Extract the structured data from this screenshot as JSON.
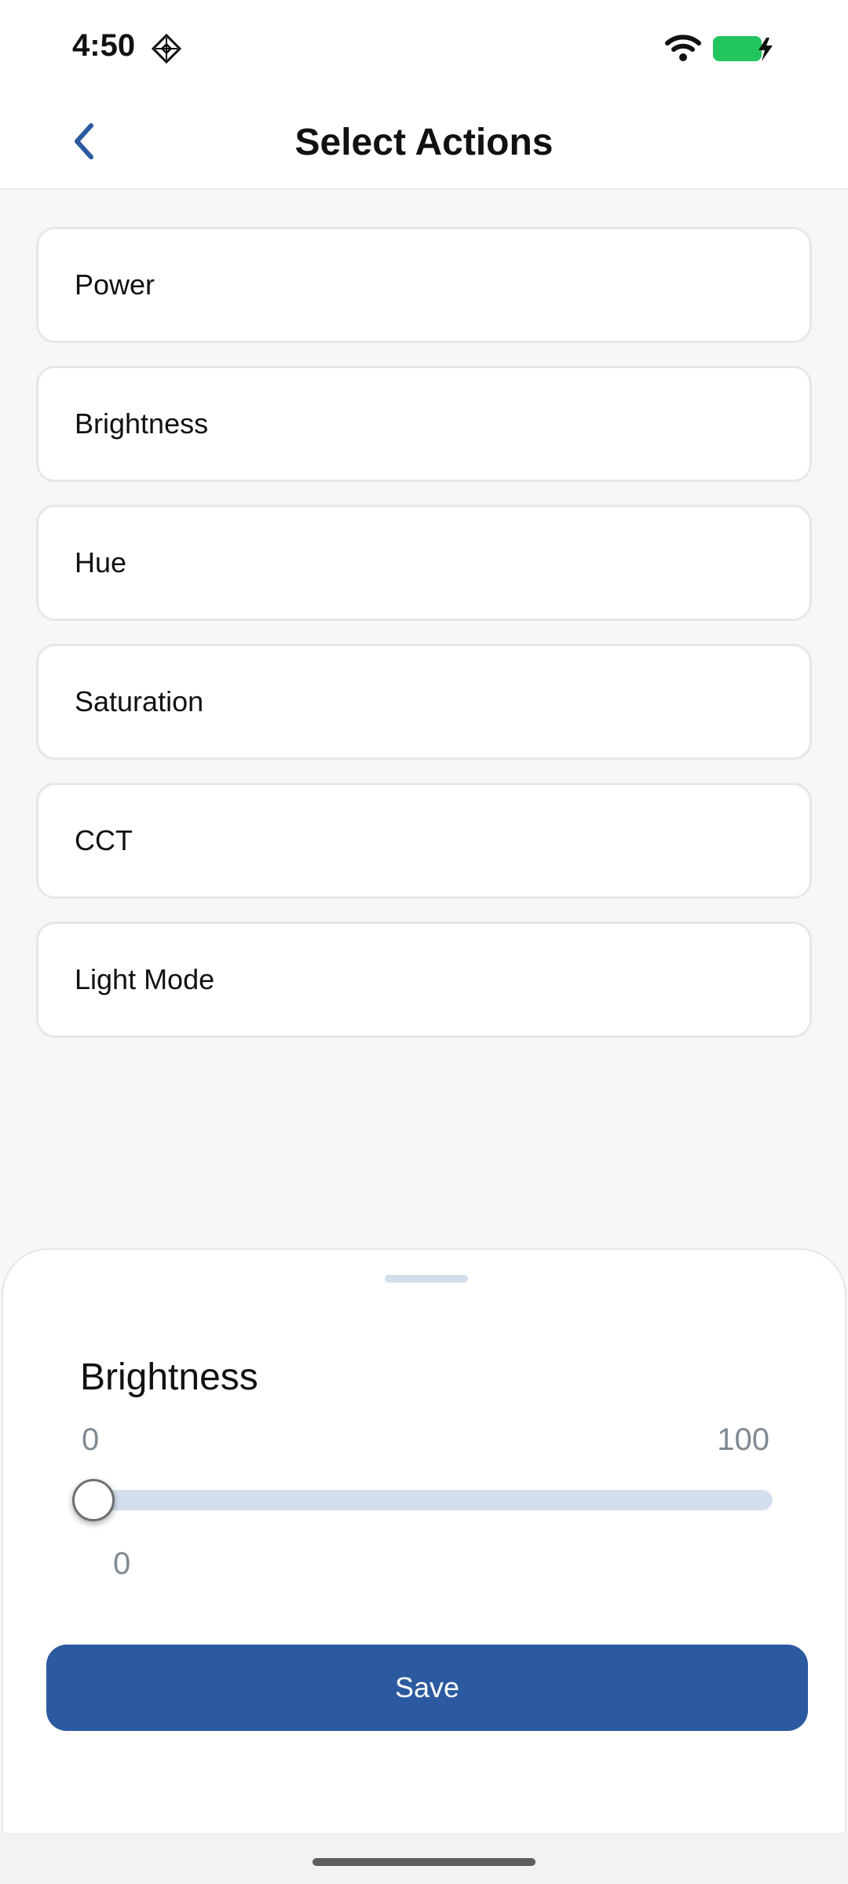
{
  "status_bar": {
    "time": "4:50",
    "app_icon": "diamond-grid-icon",
    "wifi_icon": "wifi-icon",
    "battery_icon": "battery-charging-icon",
    "battery_color": "#22c55e"
  },
  "header": {
    "title": "Select Actions",
    "back_icon": "chevron-left-icon",
    "accent_color": "#2c5aa0"
  },
  "actions": [
    {
      "label": "Power"
    },
    {
      "label": "Brightness"
    },
    {
      "label": "Hue"
    },
    {
      "label": "Saturation"
    },
    {
      "label": "CCT"
    },
    {
      "label": "Light Mode"
    }
  ],
  "sheet": {
    "title": "Brightness",
    "min_label": "0",
    "max_label": "100",
    "value": "0",
    "save_label": "Save"
  }
}
